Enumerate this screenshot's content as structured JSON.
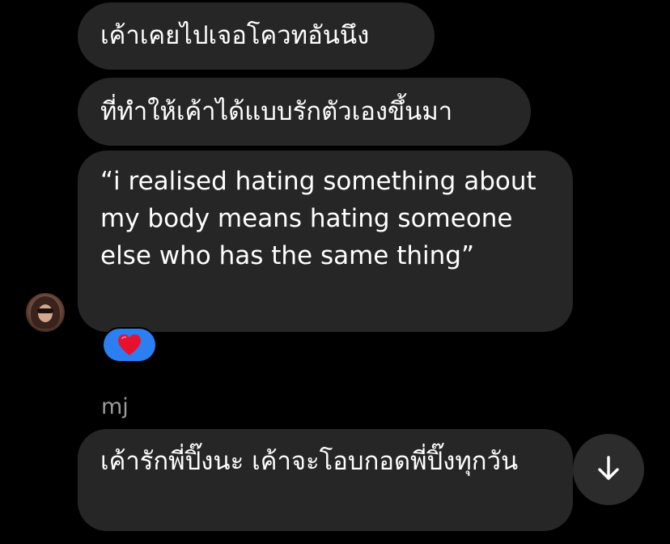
{
  "messages": [
    {
      "text": "เค้าเคยไปเจอโควทอันนึง"
    },
    {
      "text": "ที่ทำให้เค้าได้แบบรักตัวเองขึ้นมา"
    },
    {
      "text": "“i realised hating something about my body means hating someone else who has the same thing”"
    },
    {
      "text": "เค้ารักพี่ปิ๊งนะ เค้าจะโอบกอดพี่ปิ๊งทุกวัน"
    }
  ],
  "reaction": {
    "emoji": "❤️",
    "color": "#2b7ff1"
  },
  "sender_name": "mj",
  "icons": {
    "avatar": "avatar",
    "heart": "red-heart-icon",
    "scroll": "arrow-down-icon"
  },
  "colors": {
    "background": "#000000",
    "bubble": "#262626",
    "sender_label": "#9a9a9a",
    "reaction_pill": "#2b7ff1",
    "scroll_button": "#2c2c2c"
  }
}
